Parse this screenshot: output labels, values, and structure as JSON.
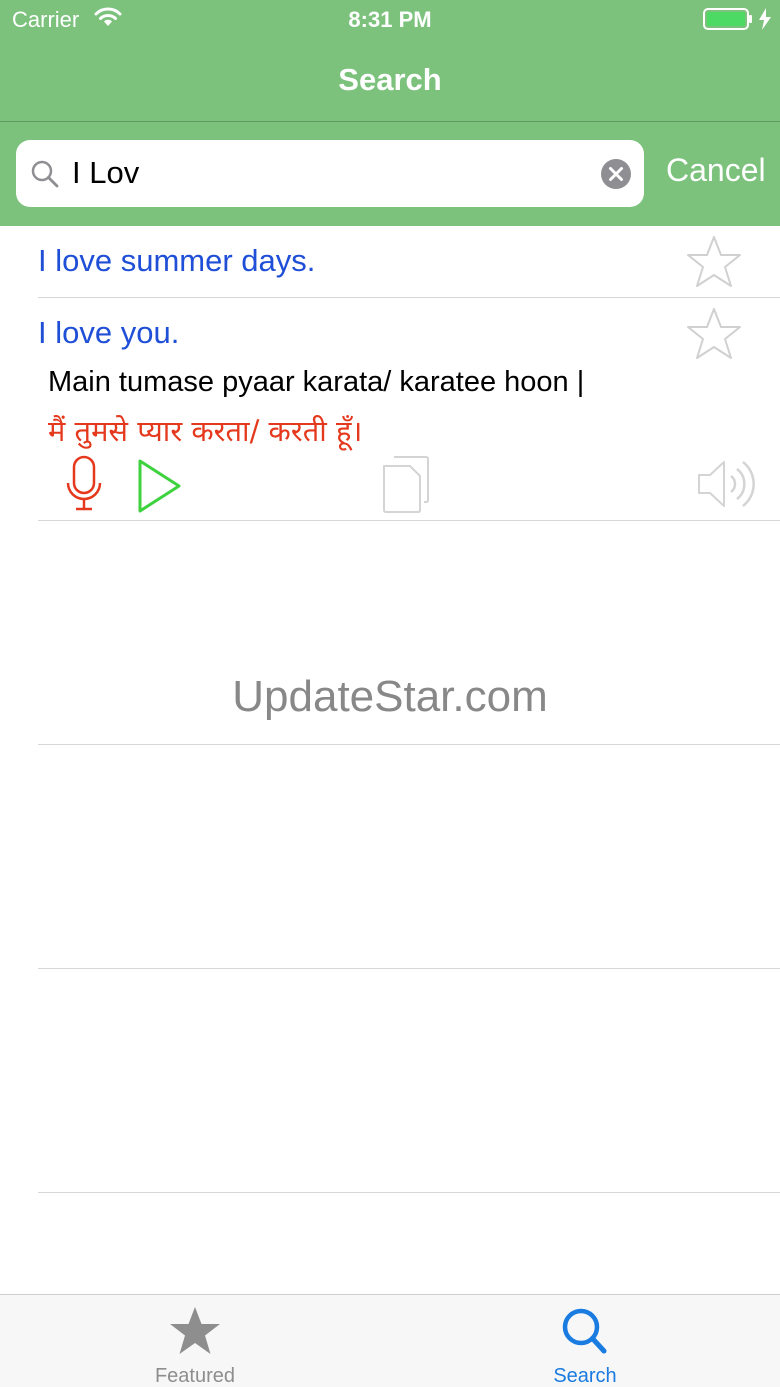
{
  "status_bar": {
    "carrier": "Carrier",
    "time": "8:31 PM"
  },
  "nav": {
    "title": "Search"
  },
  "search": {
    "value": "I Lov",
    "cancel_label": "Cancel"
  },
  "results": [
    {
      "phrase": "I love summer days."
    },
    {
      "phrase": "I love you.",
      "transliteration": "Main tumase pyaar karata/ karatee hoon |",
      "hindi": "मैं तुमसे प्यार करता/ करती हूँ।"
    }
  ],
  "watermark": "UpdateStar.com",
  "tabs": [
    {
      "label": "Featured",
      "icon": "star-icon",
      "selected": false
    },
    {
      "label": "Search",
      "icon": "search-icon",
      "selected": true
    }
  ],
  "colors": {
    "header_green": "#7cc27d",
    "phrase_blue": "#1f4fd6",
    "hindi_red": "#e5391e",
    "tab_selected": "#1a7be0",
    "tab_unselected": "#8e8e8e"
  }
}
